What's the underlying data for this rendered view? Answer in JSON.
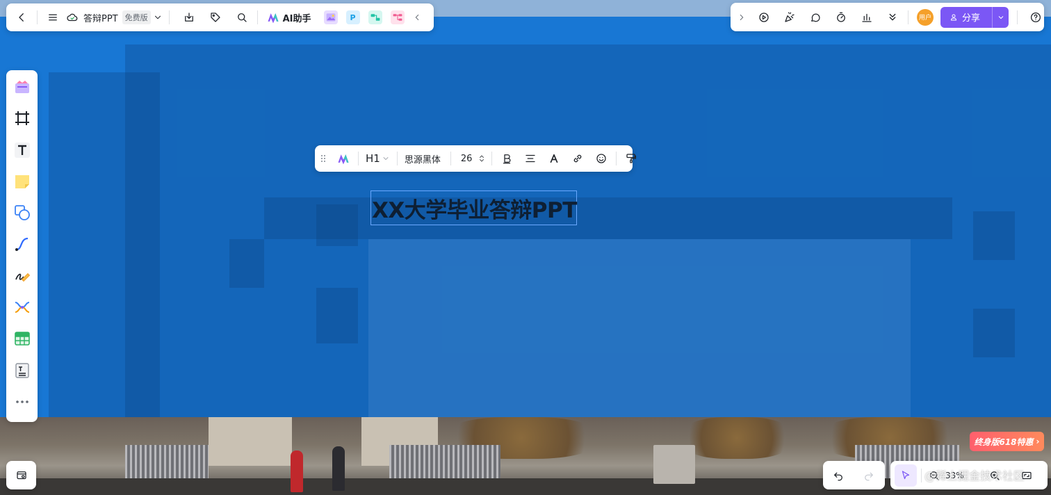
{
  "top_left": {
    "doc_title": "答辩PPT",
    "plan_badge": "免费版",
    "ai_label": "AI助手",
    "icons": [
      "back-icon",
      "menu-icon",
      "cloud-icon",
      "download-icon",
      "tag-icon",
      "search-icon"
    ]
  },
  "top_right": {
    "avatar_text": "用户",
    "share_label": "分享",
    "icons": [
      "play-icon",
      "celebrate-icon",
      "comment-icon",
      "timer-icon",
      "stats-icon",
      "collapse-icon",
      "help-icon"
    ]
  },
  "left_rail": {
    "tools": [
      "template-icon",
      "frame-icon",
      "text-icon",
      "sticky-note-icon",
      "shape-icon",
      "connector-icon",
      "pen-icon",
      "mindmap-icon",
      "table-icon",
      "doc-icon",
      "more-icon"
    ]
  },
  "format_bar": {
    "heading": "H1",
    "font_family": "思源黑体",
    "font_size": "26"
  },
  "slide": {
    "title": "XX大学毕业答辩PPT"
  },
  "bottom": {
    "zoom": "33%",
    "promo": "终身版618特惠",
    "watermark": "@稀土掘金技术社区"
  },
  "colors": {
    "accent": "#7b57f5",
    "slide_overlay": "#1877d4",
    "promo": "#ff5f6d"
  }
}
